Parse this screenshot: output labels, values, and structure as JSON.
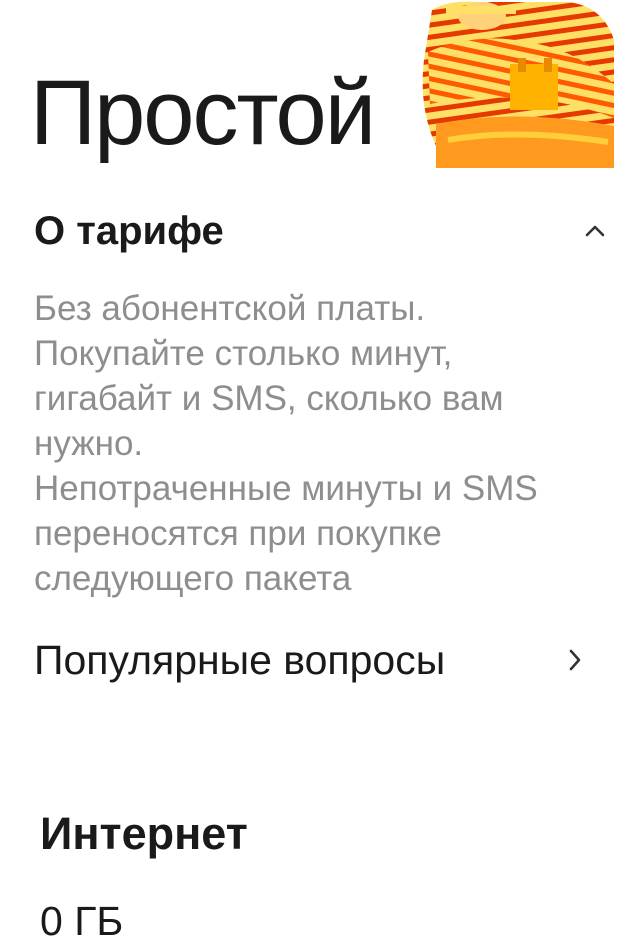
{
  "page": {
    "title": "Простой"
  },
  "hero": {
    "icon": "person-striped-sweater-illustration",
    "colors": {
      "yellow": "#ffd400",
      "orange": "#ff7a1a",
      "red": "#e63900"
    }
  },
  "about": {
    "title": "О тарифе",
    "expanded": true,
    "description": [
      "Без абонентской платы.",
      "Покупайте столько минут, гигабайт и SMS, сколько вам нужно.",
      "Непотраченные минуты и SMS переносятся при покупке следующего пакета"
    ]
  },
  "faq": {
    "label": "Популярные вопросы"
  },
  "internet": {
    "title": "Интернет",
    "value": "0 ГБ"
  }
}
